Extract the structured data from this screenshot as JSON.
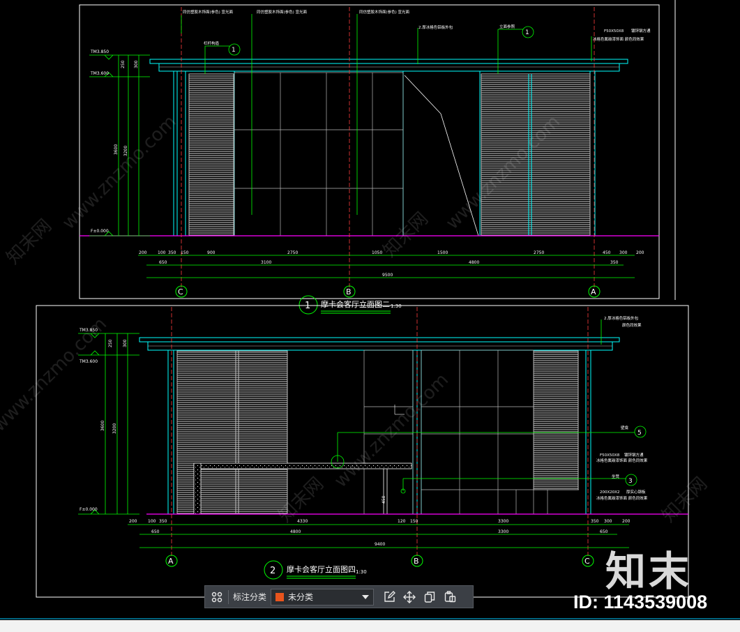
{
  "colors": {
    "background": "#000000",
    "frame": "#ffffff",
    "dimension": "#00ff00",
    "wall": "#00ffff",
    "glass_grid": "#c0c0c0",
    "floor": "#ff00ff",
    "axis": "#ff3b3b",
    "leader_text": "#ffffff"
  },
  "elevation_1": {
    "title_no": "1",
    "title": "摩卡会客厅立面图二",
    "scale": "1:30",
    "levels": [
      "TM3.850",
      "TM3.600",
      "F±0.000"
    ],
    "heights": [
      "250",
      "3600",
      "3200",
      "300"
    ],
    "dims_row1": [
      "200",
      "100",
      "350",
      "150",
      "900",
      "2750",
      "1050",
      "1500",
      "2750",
      "450",
      "300",
      "200"
    ],
    "dims_row2": [
      "650",
      "3100",
      "4800",
      "350"
    ],
    "dims_total": "9500",
    "axes": [
      "C",
      "B",
      "A"
    ],
    "leader_1": "1",
    "leader_2": "1",
    "note_1": "同仿塑胶木饰面(参色) 宣光面",
    "note_2": "同仿塑胶木饰面(参色) 宣光面",
    "note_3": "同仿塑胶木饰面(参色) 宣光面",
    "note_4": "2.厚冰格色铝板外包",
    "note_5": "F50X50X8",
    "note_6": "镀锌钢方通",
    "note_7": "冰格色氟碳漆饰面 颜色同效果",
    "note_8": "栏杆构造",
    "note_9": "立面参照"
  },
  "elevation_2": {
    "title_no": "2",
    "title": "摩卡会客厅立面图四",
    "scale": "1:30",
    "levels": [
      "TM3.850",
      "TM3.600",
      "F±0.000"
    ],
    "heights": [
      "250",
      "3600",
      "3200",
      "300"
    ],
    "dims_row1": [
      "200",
      "100",
      "350",
      "4330",
      "120",
      "150",
      "3300",
      "350",
      "300",
      "200"
    ],
    "dims_row2": [
      "650",
      "4800",
      "3300",
      "650"
    ],
    "dims_total": "9400",
    "axes": [
      "A",
      "B",
      "C"
    ],
    "leader_5": "5",
    "leader_3": "3",
    "note_1": "2.厚冰格色铝板外包",
    "note_2": "颜色同效果",
    "note_3": "F50X50X8",
    "note_4": "镀锌钢方通",
    "note_5": "冰格色氟碳漆饰面 颜色同效果",
    "note_6": "壁龛",
    "note_7": "坐凳",
    "note_8": "200X20X2",
    "note_9": "厚实心钢板",
    "note_10": "冰格色氟碳漆饰面 颜色同效果",
    "bench_height": "450"
  },
  "toolbar": {
    "label": "标注分类",
    "selected": "未分类",
    "selected_color": "#e8541d",
    "icons": [
      "category-grid-icon",
      "edit-icon",
      "move-icon",
      "copy-icon",
      "paste-icon"
    ]
  },
  "watermark": {
    "logo": "知末",
    "id_text": "ID: 1143539008",
    "site": "www.znzmo.com",
    "cn": "知末网"
  }
}
